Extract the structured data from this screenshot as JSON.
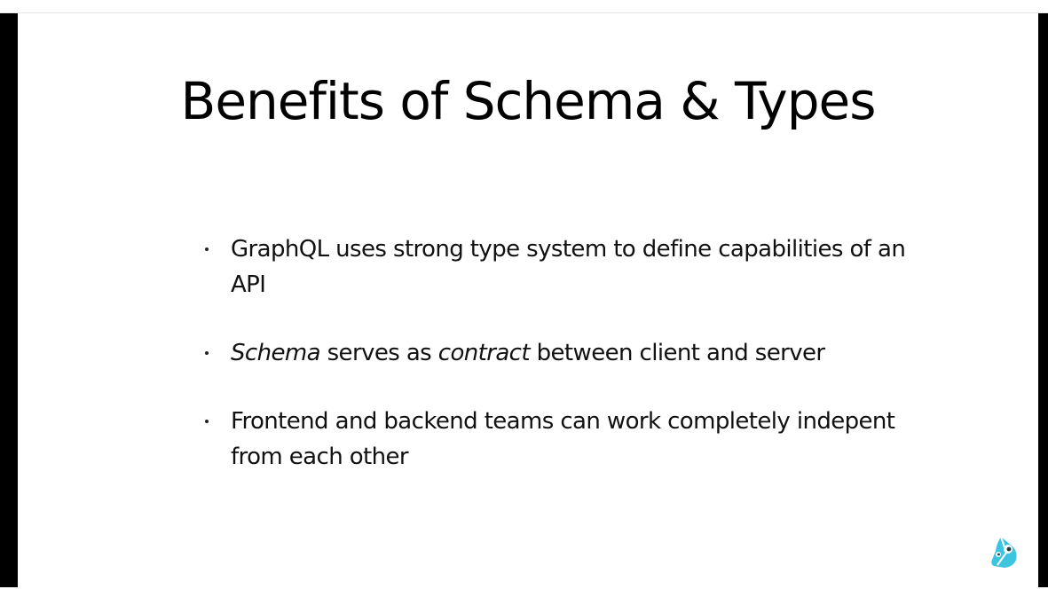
{
  "slide": {
    "title": "Benefits of Schema & Types",
    "bullets": [
      {
        "text": "GraphQL uses strong type system to define capabilities of an API"
      },
      {
        "parts": [
          "Schema",
          " serves as ",
          "contract",
          " between client and server"
        ]
      },
      {
        "text": "Frontend and backend teams can work completely indepent from each other"
      }
    ],
    "logo_icon": "prisma-bird-icon",
    "logo_color": "#3cc4e0"
  }
}
